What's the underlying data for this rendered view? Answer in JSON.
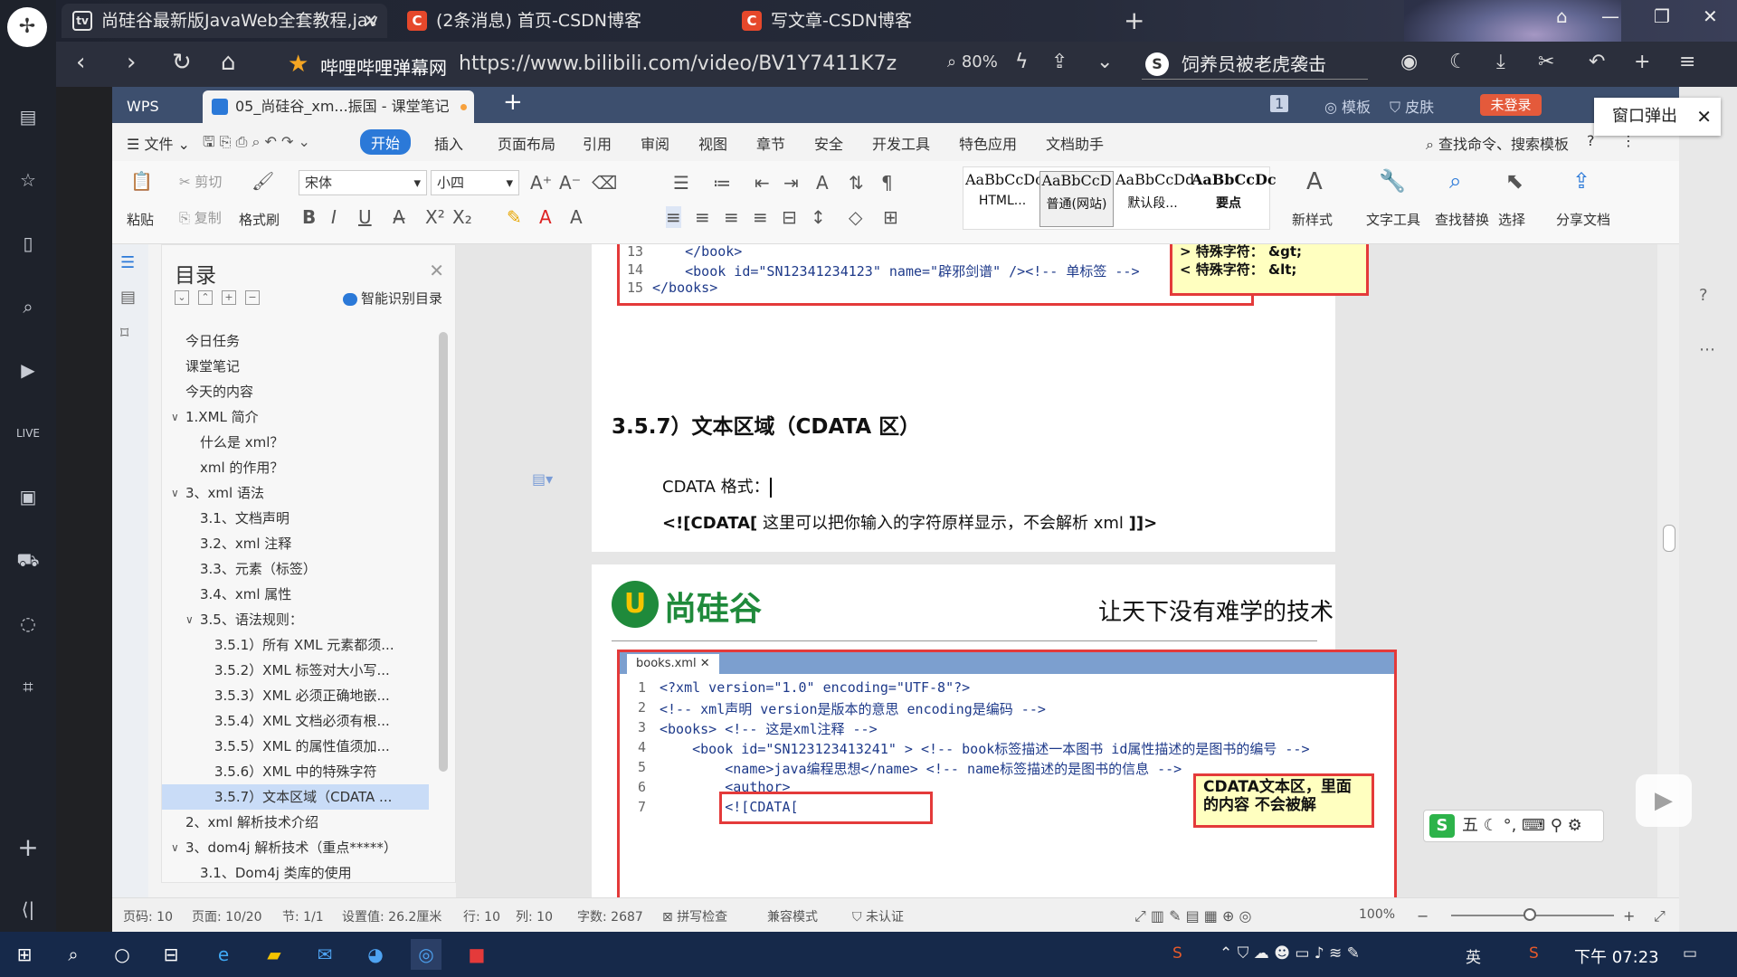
{
  "browser": {
    "tabs": [
      {
        "label": "尚硅谷最新版JavaWeb全套教程,jav"
      },
      {
        "label": "(2条消息) 首页-CSDN博客"
      },
      {
        "label": "写文章-CSDN博客"
      }
    ],
    "site_name": "哔哩哔哩弹幕网",
    "url": "https://www.bilibili.com/video/BV1Y7411K7z",
    "zoom": "80%",
    "search_text": "饲养员被老虎袭击"
  },
  "wps": {
    "app_tab": "WPS",
    "doc_tab": "05_尚硅谷_xm...振国 - 课堂笔记",
    "page_badge": "1",
    "template_label": "模板",
    "skin_label": "皮肤",
    "login_label": "未登录",
    "popup_label": "窗口弹出",
    "menu": [
      "文件",
      "开始",
      "插入",
      "页面布局",
      "引用",
      "审阅",
      "视图",
      "章节",
      "安全",
      "开发工具",
      "特色应用",
      "文档助手"
    ],
    "menu_search": "查找命令、搜索模板",
    "ribbon": {
      "paste": "粘贴",
      "cut": "剪切",
      "copy": "复制",
      "format_painter": "格式刷",
      "font": "宋体",
      "size": "小四",
      "styles": [
        {
          "preview": "AaBbCcDc",
          "label": "HTML..."
        },
        {
          "preview": "AaBbCcD",
          "label": "普通(网站)"
        },
        {
          "preview": "AaBbCcDd",
          "label": "默认段..."
        },
        {
          "preview": "AaBbCcDc",
          "label": "要点"
        }
      ],
      "new_style": "新样式",
      "text_tools": "文字工具",
      "find_replace": "查找替换",
      "select": "选择",
      "share": "分享文档"
    },
    "toc": {
      "title": "目录",
      "smart": "智能识别目录",
      "items": [
        {
          "label": "今日任务",
          "level": 1
        },
        {
          "label": "课堂笔记",
          "level": 1
        },
        {
          "label": "今天的内容",
          "level": 1
        },
        {
          "label": "1.XML 简介",
          "level": 1,
          "expanded": true
        },
        {
          "label": "什么是 xml？",
          "level": 2
        },
        {
          "label": "xml 的作用？",
          "level": 2
        },
        {
          "label": "3、xml 语法",
          "level": 1,
          "expanded": true
        },
        {
          "label": "3.1、文档声明",
          "level": 2
        },
        {
          "label": "3.2、xml 注释",
          "level": 2
        },
        {
          "label": "3.3、元素（标签）",
          "level": 2
        },
        {
          "label": "3.4、xml 属性",
          "level": 2
        },
        {
          "label": "3.5、语法规则：",
          "level": 2,
          "expanded": true
        },
        {
          "label": "3.5.1）所有 XML 元素都须...",
          "level": 3
        },
        {
          "label": "3.5.2）XML 标签对大小写...",
          "level": 3
        },
        {
          "label": "3.5.3）XML 必须正确地嵌...",
          "level": 3
        },
        {
          "label": "3.5.4）XML 文档必须有根...",
          "level": 3
        },
        {
          "label": "3.5.5）XML 的属性值须加...",
          "level": 3
        },
        {
          "label": "3.5.6）XML 中的特殊字符",
          "level": 3
        },
        {
          "label": "3.5.7）文本区域（CDATA ...",
          "level": 3,
          "selected": true
        },
        {
          "label": "2、xml 解析技术介绍",
          "level": 1
        },
        {
          "label": "3、dom4j 解析技术（重点*****）",
          "level": 1,
          "expanded": true
        },
        {
          "label": "3.1、Dom4j 类库的使用",
          "level": 2
        }
      ]
    },
    "doc": {
      "code_top": [
        {
          "n": "13",
          "text": "    </book>"
        },
        {
          "n": "14",
          "text": "    <book id=\"SN12341234123\" name=\"辟邪剑谱\" /><!-- 单标签 -->"
        },
        {
          "n": "15",
          "text": "</books>"
        }
      ],
      "callout_top": [
        "> 特殊字符： &gt;",
        "< 特殊字符： &lt;"
      ],
      "heading": "3.5.7）文本区域（CDATA 区）",
      "cdata_label": "CDATA 格式：",
      "cdata_line_bold1": "<![CDATA[",
      "cdata_line_text": " 这里可以把你输入的字符原样显示，不会解析 xml ",
      "cdata_line_bold2": "]]>",
      "logo_text": "尚硅谷",
      "slogan": "让天下没有难学的技术",
      "file_tab": "books.xml",
      "code_bottom": [
        {
          "n": "1",
          "text": "<?xml version=\"1.0\" encoding=\"UTF-8\"?>"
        },
        {
          "n": "2",
          "text": "<!-- xml声明 version是版本的意思 encoding是编码 -->"
        },
        {
          "n": "3",
          "text": "<books> <!-- 这是xml注释 -->"
        },
        {
          "n": "4",
          "text": "    <book id=\"SN123123413241\" > <!-- book标签描述一本图书 id属性描述的是图书的编号 -->"
        },
        {
          "n": "5",
          "text": "        <name>java编程思想</name> <!-- name标签描述的是图书的信息 -->"
        },
        {
          "n": "6",
          "text": "        <author>"
        },
        {
          "n": "7",
          "text": "        <![CDATA["
        }
      ],
      "callout_bottom": "CDATA文本区，里面的内容 不会被解"
    },
    "status": {
      "page_code": "页码: 10",
      "page": "页面: 10/20",
      "section": "节: 1/1",
      "setting": "设置值: 26.2厘米",
      "row": "行: 10",
      "col": "列: 10",
      "words": "字数: 2687",
      "spell": "拼写检查",
      "compat": "兼容模式",
      "cert": "未认证",
      "zoom": "100%"
    },
    "ime": "五"
  },
  "taskbar": {
    "time": "下午 07:23",
    "ime_label": "英"
  }
}
